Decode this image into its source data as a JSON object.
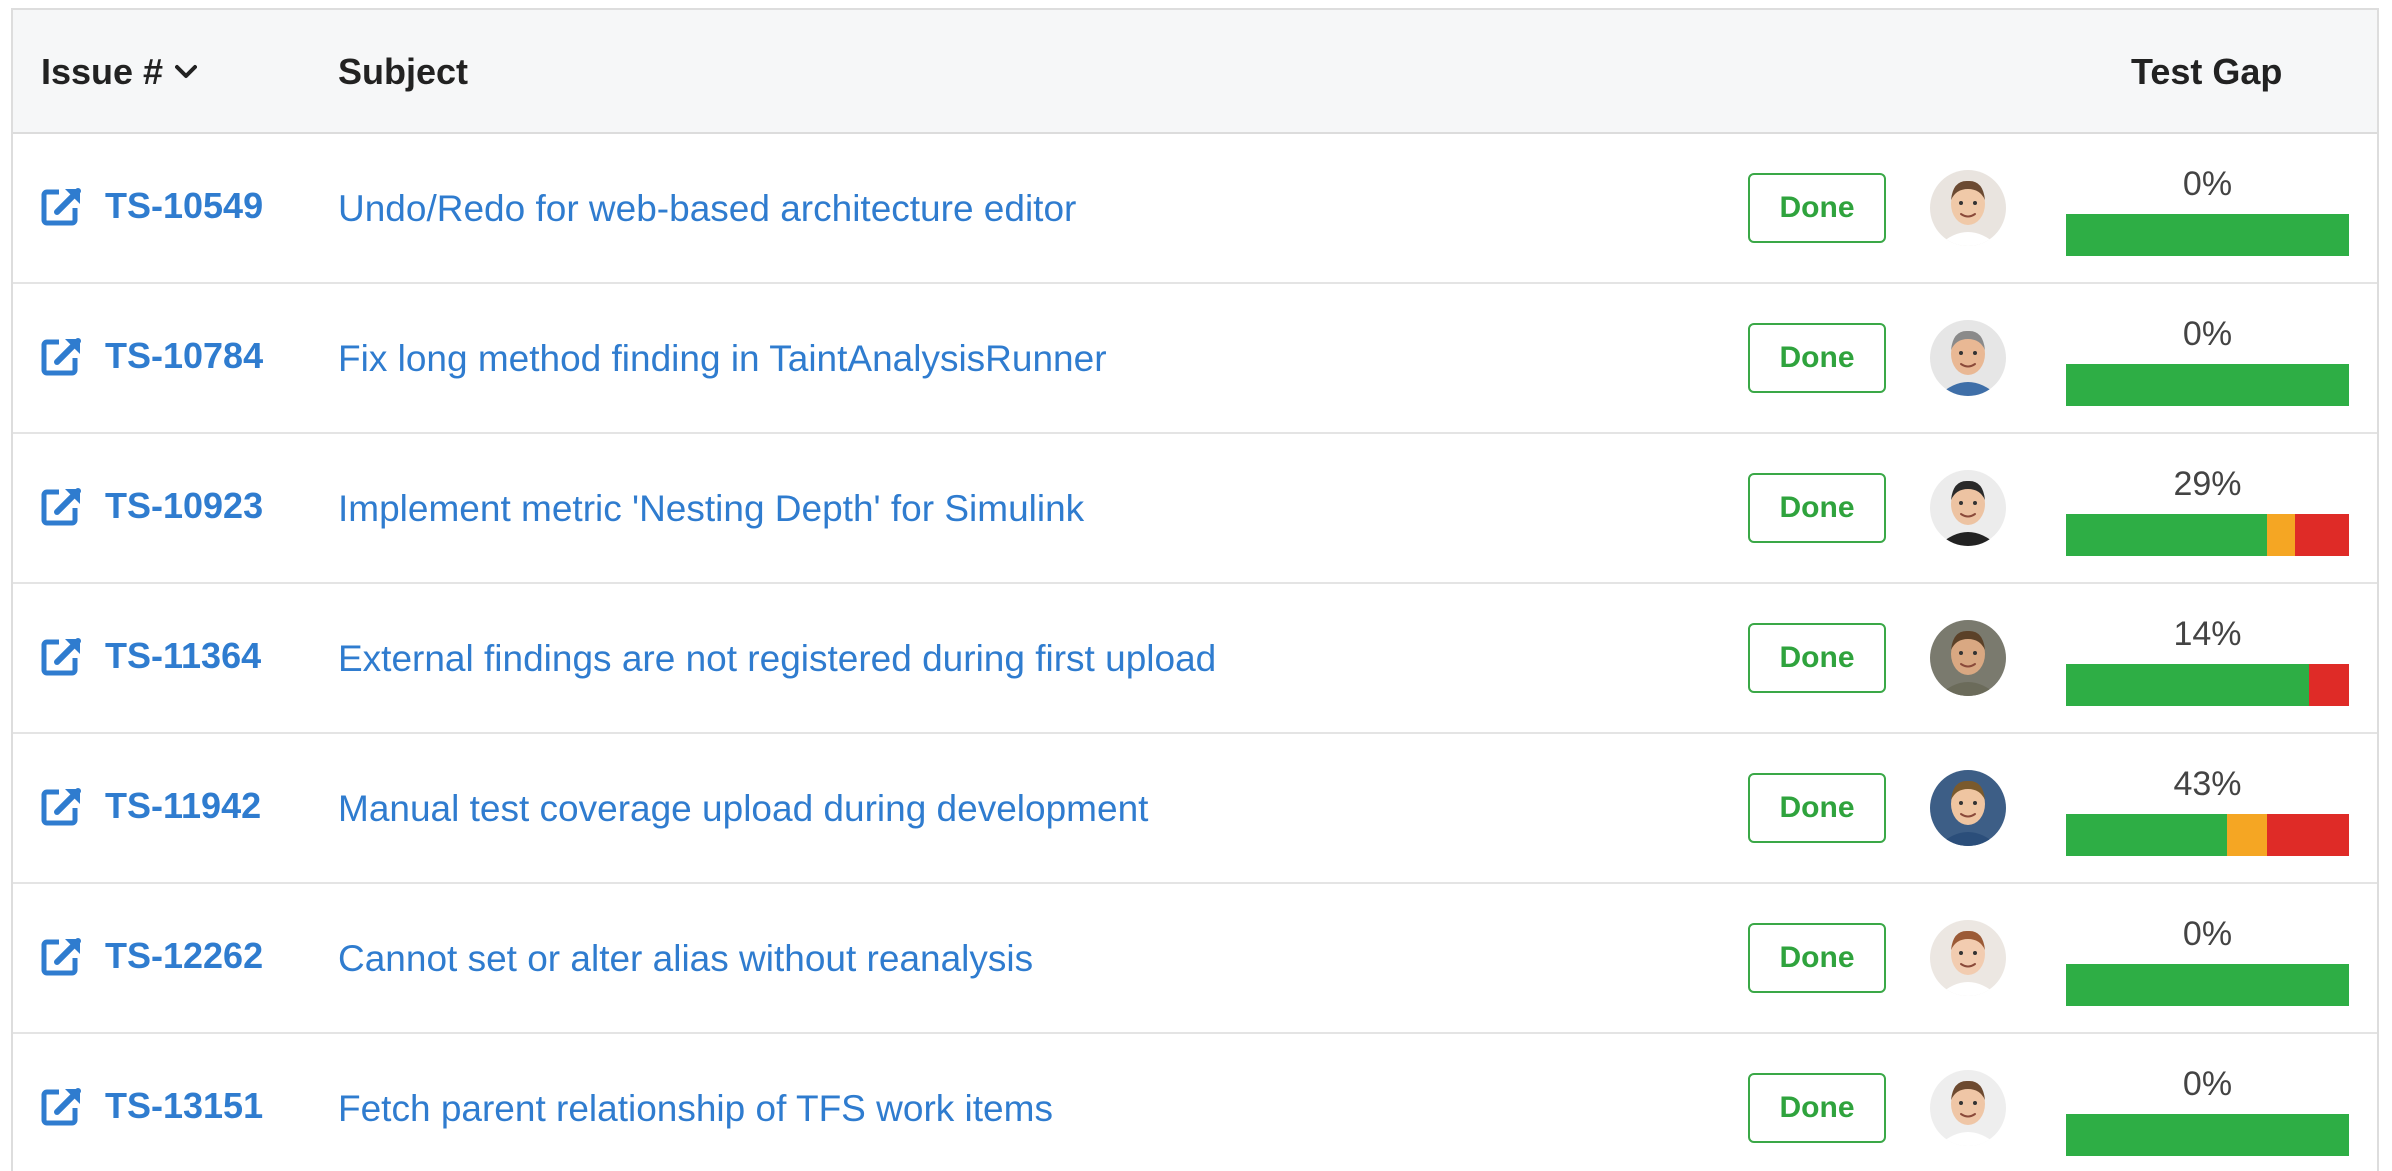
{
  "header": {
    "issue_label": "Issue #",
    "subject_label": "Subject",
    "test_gap_label": "Test Gap"
  },
  "icons": {
    "external_link": "external-link-icon",
    "sort": "chevron-down-icon"
  },
  "colors": {
    "link": "#2f7ccf",
    "done": "#2fa33d",
    "gap_green": "#2eae45",
    "gap_orange": "#f5a623",
    "gap_red": "#df2b27"
  },
  "rows": [
    {
      "id": "TS-10549",
      "subject": "Undo/Redo for web-based architecture editor",
      "status": "Done",
      "gap_label": "0%",
      "gap": {
        "green": 100,
        "orange": 0,
        "red": 0
      }
    },
    {
      "id": "TS-10784",
      "subject": "Fix long method finding in TaintAnalysisRunner",
      "status": "Done",
      "gap_label": "0%",
      "gap": {
        "green": 100,
        "orange": 0,
        "red": 0
      }
    },
    {
      "id": "TS-10923",
      "subject": "Implement metric 'Nesting Depth' for Simulink",
      "status": "Done",
      "gap_label": "29%",
      "gap": {
        "green": 71,
        "orange": 10,
        "red": 19
      }
    },
    {
      "id": "TS-11364",
      "subject": "External findings are not registered during first upload",
      "status": "Done",
      "gap_label": "14%",
      "gap": {
        "green": 86,
        "orange": 0,
        "red": 14
      }
    },
    {
      "id": "TS-11942",
      "subject": "Manual test coverage upload during development",
      "status": "Done",
      "gap_label": "43%",
      "gap": {
        "green": 57,
        "orange": 14,
        "red": 29
      }
    },
    {
      "id": "TS-12262",
      "subject": "Cannot set or alter alias without reanalysis",
      "status": "Done",
      "gap_label": "0%",
      "gap": {
        "green": 100,
        "orange": 0,
        "red": 0
      }
    },
    {
      "id": "TS-13151",
      "subject": "Fetch parent relationship of TFS work items",
      "status": "Done",
      "gap_label": "0%",
      "gap": {
        "green": 100,
        "orange": 0,
        "red": 0
      }
    }
  ]
}
